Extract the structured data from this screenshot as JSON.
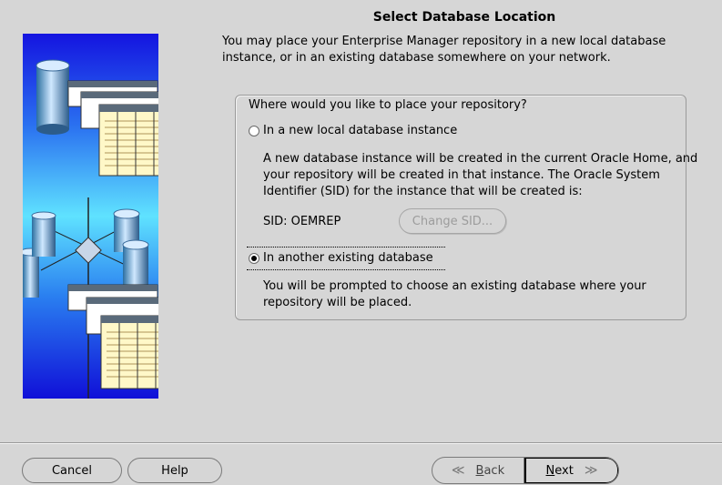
{
  "page": {
    "title": "Select Database Location",
    "intro": "You may place your Enterprise Manager repository in a new local database instance, or in an existing database somewhere on your network."
  },
  "group": {
    "legend": "Where would you like to place your repository?",
    "option_new": {
      "label": "In a new local database instance",
      "selected": false,
      "description": "A new database instance will be created in the current Oracle Home, and your repository will be created in that instance.  The Oracle System Identifier (SID) for the instance that will be created is:",
      "sid_text": "SID: OEMREP",
      "change_sid_label": "Change SID..."
    },
    "option_existing": {
      "label": "In another existing database",
      "selected": true,
      "description": "You will be prompted to choose an existing database where your repository will be placed."
    }
  },
  "footer": {
    "cancel_label": "Cancel",
    "help_label": "Help",
    "back_mnemonic": "B",
    "back_rest": "ack",
    "next_mnemonic": "N",
    "next_rest": "ext"
  },
  "colors": {
    "graphic_blue": "#1515e6",
    "graphic_cyan": "#6fe0ff",
    "background": "#d6d6d6"
  }
}
